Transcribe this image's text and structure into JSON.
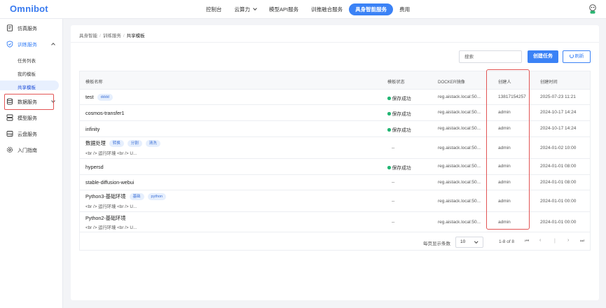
{
  "app": {
    "logo": "Omnibot"
  },
  "topnav": {
    "items": [
      {
        "label": "控制台",
        "active": false,
        "dropdown": false
      },
      {
        "label": "云算力",
        "active": false,
        "dropdown": true
      },
      {
        "label": "模型API服务",
        "active": false,
        "dropdown": false
      },
      {
        "label": "训推融合服务",
        "active": false,
        "dropdown": false
      },
      {
        "label": "具身智能服务",
        "active": true,
        "dropdown": false
      },
      {
        "label": "费用",
        "active": false,
        "dropdown": false
      }
    ]
  },
  "sidebar": {
    "items": [
      {
        "label": "仿真服务",
        "icon": "document-icon"
      },
      {
        "label": "训练服务",
        "icon": "shield-icon",
        "expanded": true,
        "children": [
          {
            "label": "任务列表",
            "active": false
          },
          {
            "label": "我的模板",
            "active": false
          },
          {
            "label": "共享模板",
            "active": true
          }
        ]
      },
      {
        "label": "数据服务",
        "icon": "database-icon",
        "expanded": false
      },
      {
        "label": "模型服务",
        "icon": "server-icon"
      },
      {
        "label": "云盘服务",
        "icon": "disk-icon"
      },
      {
        "label": "入门指南",
        "icon": "gear-icon"
      }
    ]
  },
  "breadcrumb": [
    "具身智能",
    "训练服务",
    "共享模板"
  ],
  "toolbar": {
    "search_placeholder": "搜索",
    "create_label": "创建任务",
    "refresh_label": "刷新"
  },
  "table": {
    "headers": [
      "模板名称",
      "模板状态",
      "DOCKER镜像",
      "创建人",
      "创建时间"
    ],
    "rows": [
      {
        "name": "test",
        "tags": [
          "dddd"
        ],
        "desc": "",
        "status": "保存成功",
        "image": "reg.aistack.local:50...",
        "creator": "13817154257",
        "created": "2025-07-23 11:21"
      },
      {
        "name": "cosmos-transfer1",
        "tags": [],
        "desc": "",
        "status": "保存成功",
        "image": "reg.aistack.local:50...",
        "creator": "admin",
        "created": "2024-10-17 14:24"
      },
      {
        "name": "infinity",
        "tags": [],
        "desc": "",
        "status": "保存成功",
        "image": "reg.aistack.local:50...",
        "creator": "admin",
        "created": "2024-10-17 14:24"
      },
      {
        "name": "数据处理",
        "tags": [
          "转换",
          "分割",
          "清洗"
        ],
        "desc": "<br /> 运行环境 <br /> U...",
        "status": "--",
        "image": "reg.aistack.local:50...",
        "creator": "admin",
        "created": "2024-01-02 10:00"
      },
      {
        "name": "hypersd",
        "tags": [],
        "desc": "",
        "status": "保存成功",
        "image": "reg.aistack.local:50...",
        "creator": "admin",
        "created": "2024-01-01 08:00"
      },
      {
        "name": "stable-diffusion-webui",
        "tags": [],
        "desc": "",
        "status": "--",
        "image": "reg.aistack.local:50...",
        "creator": "admin",
        "created": "2024-01-01 08:00"
      },
      {
        "name": "Python3-基础环境",
        "tags": [
          "基础",
          "python"
        ],
        "desc": "<br /> 运行环境 <br /> U...",
        "status": "--",
        "image": "reg.aistack.local:50...",
        "creator": "admin",
        "created": "2024-01-01 00:00"
      },
      {
        "name": "Python2-基础环境",
        "tags": [],
        "desc": "<br /> 运行环境 <br /> U...",
        "status": "--",
        "image": "reg.aistack.local:50...",
        "creator": "admin",
        "created": "2024-01-01 00:00"
      }
    ]
  },
  "pagination": {
    "per_page_label": "每页显示条数",
    "per_page_value": "10",
    "range_label": "1-8 of 8",
    "first": "⏮",
    "prev": "‹",
    "next": "›",
    "last": "⏭"
  },
  "colors": {
    "accent": "#3b82f6",
    "success": "#22b573",
    "highlight": "#e25555"
  }
}
